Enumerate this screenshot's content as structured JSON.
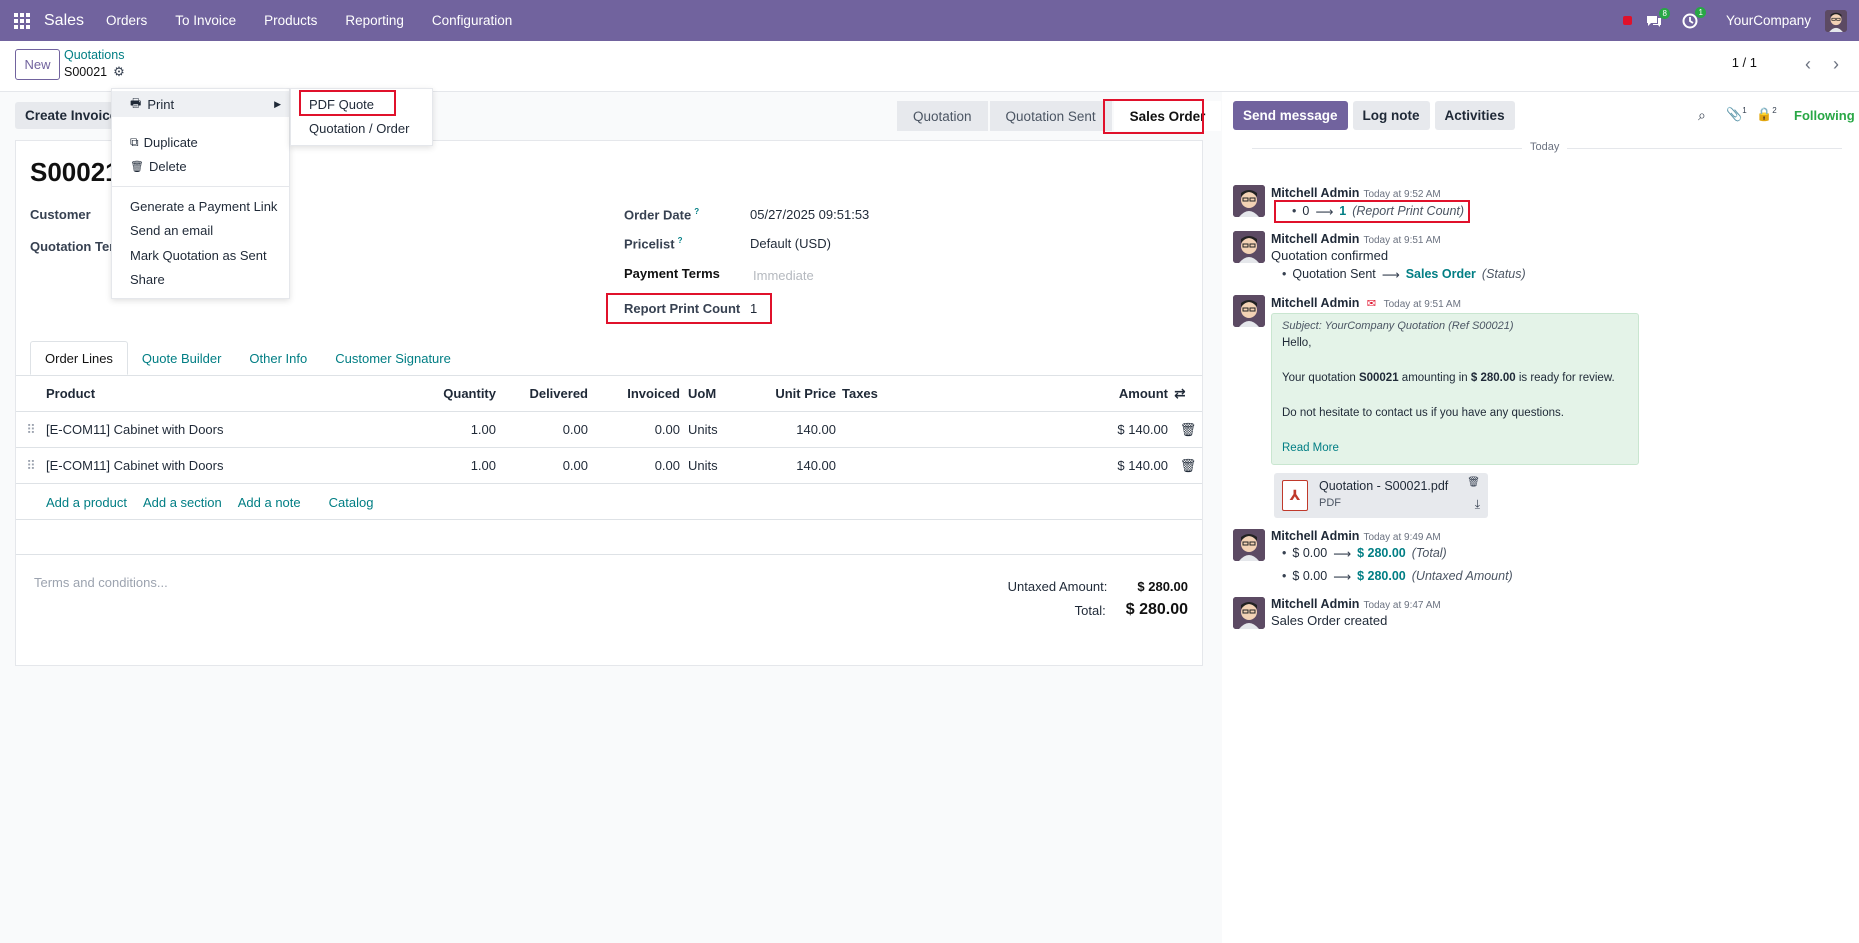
{
  "navbar": {
    "app_name": "Sales",
    "menu": [
      "Orders",
      "To Invoice",
      "Products",
      "Reporting",
      "Configuration"
    ],
    "messages_badge": "8",
    "activities_badge": "1",
    "company": "YourCompany"
  },
  "control": {
    "new_label": "New",
    "breadcrumb_parent": "Quotations",
    "breadcrumb_current": "S00021",
    "pager": "1 / 1"
  },
  "actions": {
    "create_invoice": "Create Invoice",
    "stages": [
      "Quotation",
      "Quotation Sent",
      "Sales Order"
    ],
    "active_stage": "Sales Order"
  },
  "gear_menu": {
    "print": "Print",
    "duplicate": "Duplicate",
    "delete": "Delete",
    "payment_link": "Generate a Payment Link",
    "send_email": "Send an email",
    "mark_sent": "Mark Quotation as Sent",
    "share": "Share"
  },
  "print_menu": {
    "pdf_quote": "PDF Quote",
    "quotation_order": "Quotation / Order"
  },
  "form": {
    "title": "S00021",
    "customer_label": "Customer",
    "quotation_template_label": "Quotation Ter",
    "order_date_label": "Order Date",
    "order_date_value": "05/27/2025 09:51:53",
    "pricelist_label": "Pricelist",
    "pricelist_value": "Default (USD)",
    "payment_terms_label": "Payment Terms",
    "payment_terms_placeholder": "Immediate",
    "report_print_count_label": "Report Print Count",
    "report_print_count_value": "1",
    "tooltip_mark": "?"
  },
  "tabs": [
    "Order Lines",
    "Quote Builder",
    "Other Info",
    "Customer Signature"
  ],
  "lines": {
    "headers": {
      "product": "Product",
      "quantity": "Quantity",
      "delivered": "Delivered",
      "invoiced": "Invoiced",
      "uom": "UoM",
      "unit_price": "Unit Price",
      "taxes": "Taxes",
      "amount": "Amount"
    },
    "rows": [
      {
        "product": "[E-COM11] Cabinet with Doors",
        "quantity": "1.00",
        "delivered": "0.00",
        "invoiced": "0.00",
        "uom": "Units",
        "unit_price": "140.00",
        "taxes": "",
        "amount": "$ 140.00"
      },
      {
        "product": "[E-COM11] Cabinet with Doors",
        "quantity": "1.00",
        "delivered": "0.00",
        "invoiced": "0.00",
        "uom": "Units",
        "unit_price": "140.00",
        "taxes": "",
        "amount": "$ 140.00"
      }
    ],
    "add_product": "Add a product",
    "add_section": "Add a section",
    "add_note": "Add a note",
    "catalog": "Catalog"
  },
  "footer": {
    "terms_placeholder": "Terms and conditions...",
    "untaxed_label": "Untaxed Amount:",
    "untaxed_value": "$ 280.00",
    "total_label": "Total:",
    "total_value": "$ 280.00"
  },
  "chatter": {
    "send_message": "Send message",
    "log_note": "Log note",
    "activities": "Activities",
    "attachments_count": "1",
    "followers_count": "2",
    "following": "Following",
    "date_separator": "Today",
    "messages": [
      {
        "author": "Mitchell Admin",
        "time": "Today at 9:52 AM",
        "old": "0",
        "new": "1",
        "field": "(Report Print Count)"
      },
      {
        "author": "Mitchell Admin",
        "time": "Today at 9:51 AM",
        "body": "Quotation confirmed",
        "old": "Quotation Sent",
        "new": "Sales Order",
        "field": "(Status)"
      },
      {
        "author": "Mitchell Admin",
        "time": "Today at 9:51 AM",
        "subject": "Subject: YourCompany Quotation (Ref S00021)",
        "hello": "Hello,",
        "line_a": "Your quotation ",
        "ref": "S00021",
        "line_b": " amounting in ",
        "amount": "$ 280.00",
        "line_c": " is ready for review.",
        "line2": "Do not hesitate to contact us if you have any questions.",
        "read_more": "Read More",
        "attachment_name": "Quotation - S00021.pdf",
        "attachment_type": "PDF"
      },
      {
        "author": "Mitchell Admin",
        "time": "Today at 9:49 AM",
        "change1_old": "$ 0.00",
        "change1_new": "$ 280.00",
        "change1_field": "(Total)",
        "change2_old": "$ 0.00",
        "change2_new": "$ 280.00",
        "change2_field": "(Untaxed Amount)"
      },
      {
        "author": "Mitchell Admin",
        "time": "Today at 9:47 AM",
        "body": "Sales Order created"
      }
    ]
  },
  "colors": {
    "brand": "#71639e",
    "link": "#017e84",
    "highlight": "#e0112b"
  }
}
